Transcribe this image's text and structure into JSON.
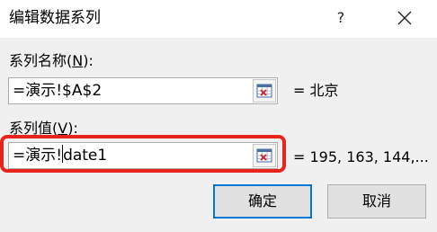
{
  "dialog": {
    "title": "编辑数据系列",
    "help_label": "?"
  },
  "series_name": {
    "label_prefix": "系列名称(",
    "label_accel": "N",
    "label_suffix": "):",
    "value": "=演示!$A$2",
    "result": "= 北京"
  },
  "series_values": {
    "label_prefix": "系列值(",
    "label_accel": "V",
    "label_suffix": "):",
    "value_before_caret": "=演示!",
    "value_after_caret": "date1",
    "result": "= 195, 163, 144,..."
  },
  "buttons": {
    "ok_label": "确定",
    "cancel_label": "取消"
  },
  "icons": {
    "help": "help-icon",
    "close": "close-icon",
    "collapse": "range-collapse-icon"
  },
  "colors": {
    "highlight": "#e8241c",
    "default_button_border": "#0078d7",
    "dialog_background": "#f0f0f0"
  }
}
